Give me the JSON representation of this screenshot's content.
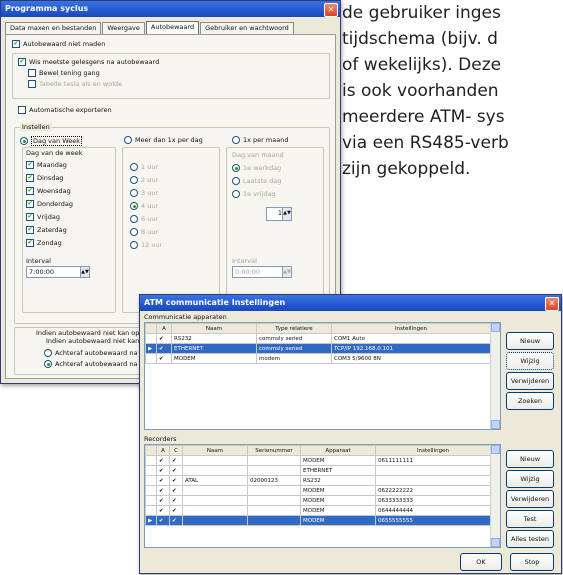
{
  "doc_text": {
    "lines": [
      "de gebruiker inges",
      "tijdschema (bijv. d",
      "of wekelijks). Deze",
      "is ook voorhanden",
      "meerdere ATM- sys",
      "via een RS485-verb",
      "zijn gekoppeld."
    ]
  },
  "cycles_dialog": {
    "title": "Programma syclus",
    "tabs": [
      "Data maxen en bestanden",
      "Weergave",
      "Autobewaard",
      "Gebruiker en wachtwoord"
    ],
    "active_tab_index": 2,
    "auto_read_label": "Autobewaard niet maden",
    "delete_after_read_label": "Wis meetste gelesgens na autobewaard",
    "sub_option_1": "Bewel tening gang",
    "sub_option_2": "Tabelle tesla als en wolde",
    "auto_export_label": "Automatische exporteren",
    "schedule_group": "Instellen",
    "mode_days": "Dag van Week",
    "mode_each_day": "Meer dan 1x per dag",
    "mode_month": "1x per maand",
    "days_header": "Dag van de week",
    "days": [
      "Maandag",
      "Dinsdag",
      "Woensdag",
      "Donderdag",
      "Vrijdag",
      "Zaterdag",
      "Zondag"
    ],
    "time_slots": [
      "1 uur",
      "2 uur",
      "3 uur",
      "4 uur",
      "6 uur",
      "8 uur",
      "12 uur"
    ],
    "month_options": [
      "Dag van maand",
      "1e werkdag",
      "Laatste dag",
      "1e vrijdag"
    ],
    "month_day_value": "1",
    "interval_label": "Interval",
    "interval_value": "7:00:00",
    "month_time_label": "Interval",
    "month_time_value": "0:00:00",
    "bottom_text_1": "Indien autobewaard niet kan openen",
    "bottom_text_2": "Indien autobewaard niet kan op",
    "bottom_opt_1": "Achteraf autobewaard na",
    "bottom_opt_2": "Achteraf autobewaard na"
  },
  "atm_dialog": {
    "title": "ATM communicatie Instellingen",
    "comm_section": "Communicatie apparaten",
    "comm_columns": [
      "",
      "A",
      "Naam",
      "Type relatiere",
      "Instellingen"
    ],
    "comm_rows": [
      {
        "a": "✔",
        "name": "RS232",
        "type": "commsly seried",
        "settings": "COM1 Auto",
        "selected": false
      },
      {
        "a": "✔",
        "name": "ETHERNET",
        "type": "commsly seried",
        "settings": "TCP/IP 192.168.0.101",
        "selected": true
      },
      {
        "a": "✔",
        "name": "MODEM",
        "type": "modem",
        "settings": "COM3 5/9600 8N",
        "selected": false
      }
    ],
    "comm_buttons": [
      "Nieuw",
      "Wijzig",
      "Verwijderen",
      "Zoeken"
    ],
    "rec_section": "Recorders",
    "rec_columns": [
      "",
      "A",
      "C",
      "Naam",
      "Serienummer",
      "Apparaat",
      "Instellingen"
    ],
    "rec_rows": [
      {
        "a": "✔",
        "c": "✔",
        "name": "",
        "serial": "",
        "device": "MODEM",
        "settings": "0611111111",
        "selected": false
      },
      {
        "a": "✔",
        "c": "✔",
        "name": "",
        "serial": "",
        "device": "ETHERNET",
        "settings": "",
        "selected": false
      },
      {
        "a": "✔",
        "c": "✔",
        "name": "ATAL",
        "serial": "02000123",
        "device": "RS232",
        "settings": "",
        "selected": false
      },
      {
        "a": "✔",
        "c": "✔",
        "name": "",
        "serial": "",
        "device": "MODEM",
        "settings": "0622222222",
        "selected": false
      },
      {
        "a": "✔",
        "c": "✔",
        "name": "",
        "serial": "",
        "device": "MODEM",
        "settings": "0633333333",
        "selected": false
      },
      {
        "a": "✔",
        "c": "✔",
        "name": "",
        "serial": "",
        "device": "MODEM",
        "settings": "0644444444",
        "selected": false
      },
      {
        "a": "✔",
        "c": "✔",
        "name": "",
        "serial": "",
        "device": "MODEM",
        "settings": "0655555555",
        "selected": true
      }
    ],
    "rec_buttons": [
      "Nieuw",
      "Wijzig",
      "Verwijderen",
      "Test",
      "Alles testen"
    ],
    "ok_label": "OK",
    "stop_label": "Stop"
  }
}
